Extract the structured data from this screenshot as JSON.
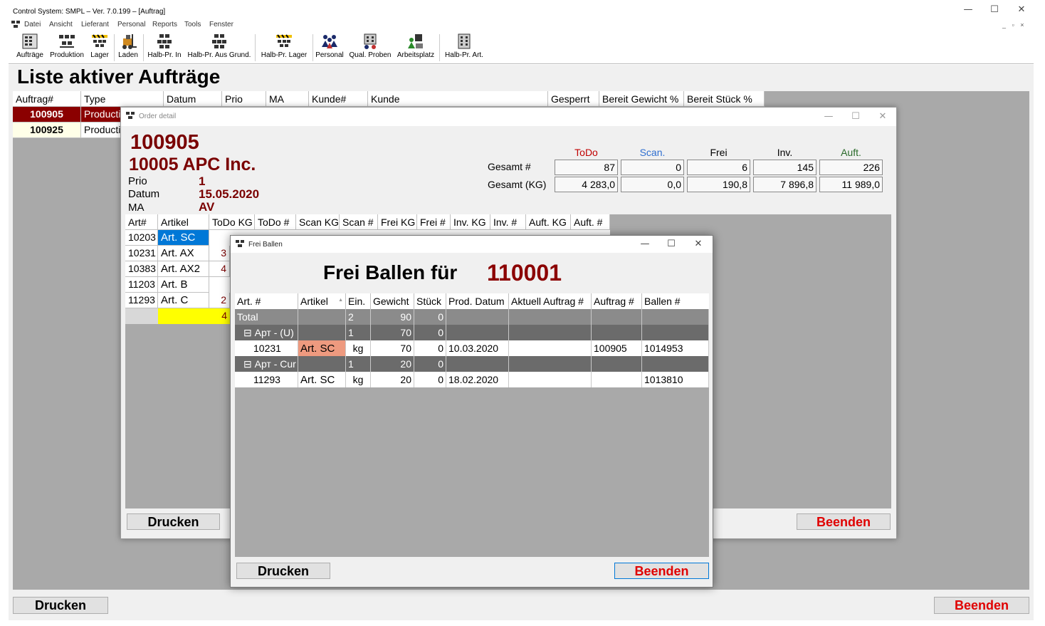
{
  "window": {
    "title": "Control System: SMPL – Ver. 7.0.199 – [Auftrag]",
    "minimize_glyph": "—",
    "maximize_glyph": "☐",
    "close_glyph": "✕",
    "mdi_controls": "_ ▫ ×"
  },
  "menu": [
    "Datei",
    "Ansicht",
    "Lieferant",
    "Personal",
    "Reports",
    "Tools",
    "Fenster"
  ],
  "toolbar": [
    {
      "label": "Aufträge",
      "icon": "orders-icon"
    },
    {
      "label": "Produktion",
      "icon": "production-icon"
    },
    {
      "label": "Lager",
      "icon": "warehouse-icon"
    },
    {
      "label": "Laden",
      "icon": "forklift-icon"
    },
    {
      "label": "Halb-Pr. In",
      "icon": "semi-product-in-icon"
    },
    {
      "label": "Halb-Pr. Aus Grund.",
      "icon": "semi-product-out-icon"
    },
    {
      "label": "Halb-Pr. Lager",
      "icon": "semi-product-warehouse-icon"
    },
    {
      "label": "Personal",
      "icon": "staff-icon"
    },
    {
      "label": "Qual. Proben",
      "icon": "quality-samples-icon"
    },
    {
      "label": "Arbeitsplatz",
      "icon": "workplace-icon"
    },
    {
      "label": "Halb-Pr. Art.",
      "icon": "semi-product-article-icon"
    }
  ],
  "main": {
    "title": "Liste aktiver Aufträge",
    "columns": [
      "Auftrag#",
      "Type",
      "Datum",
      "Prio",
      "MA",
      "Kunde#",
      "Kunde",
      "Gesperrt",
      "Bereit Gewicht %",
      "Bereit Stück %"
    ],
    "rows": [
      {
        "order": "100905",
        "type": "Productio",
        "selected": true
      },
      {
        "order": "100925",
        "type": "Productio",
        "selected": false
      }
    ],
    "print_label": "Drucken",
    "exit_label": "Beenden"
  },
  "order_detail": {
    "title": "Order detail",
    "order_number": "100905",
    "customer": "10005 APC Inc.",
    "fields": [
      {
        "label": "Prio",
        "value": "1"
      },
      {
        "label": "Datum",
        "value": "15.05.2020"
      },
      {
        "label": "MA",
        "value": "AV"
      }
    ],
    "summary_headers": [
      {
        "label": "ToDo",
        "color": "#c00000"
      },
      {
        "label": "Scan.",
        "color": "#2f6fd0"
      },
      {
        "label": "Frei",
        "color": "#000000"
      },
      {
        "label": "Inv.",
        "color": "#000000"
      },
      {
        "label": "Auft.",
        "color": "#2a6a2a"
      }
    ],
    "summary_rows": [
      {
        "label": "Gesamt #",
        "values": [
          "87",
          "0",
          "6",
          "145",
          "226"
        ]
      },
      {
        "label": "Gesamt (KG)",
        "values": [
          "4 283,0",
          "0,0",
          "190,8",
          "7 896,8",
          "11 989,0"
        ]
      }
    ],
    "columns": [
      "Art#",
      "Artikel",
      "ToDo KG",
      "ToDo #",
      "Scan KG",
      "Scan #",
      "Frei KG",
      "Frei #",
      "Inv. KG",
      "Inv. #",
      "Auft. KG",
      "Auft. #"
    ],
    "rows": [
      {
        "art": "10203",
        "artikel": "Art. SC",
        "todo_kg": "",
        "selected": true
      },
      {
        "art": "10231",
        "artikel": "Art. AX",
        "todo_kg": "3",
        "selected": false
      },
      {
        "art": "10383",
        "artikel": "Art. AX2",
        "todo_kg": "4",
        "selected": false
      },
      {
        "art": "11203",
        "artikel": "Art. B",
        "todo_kg": "",
        "selected": false
      },
      {
        "art": "11293",
        "artikel": "Art. C",
        "todo_kg": "2",
        "selected": false
      }
    ],
    "total_partial": "4",
    "print_label": "Drucken",
    "exit_label": "Beenden"
  },
  "frei_ballen": {
    "title": "Frei Ballen",
    "heading": "Frei Ballen für",
    "heading_number": "110001",
    "columns": [
      "Art. #",
      "Artikel",
      "Ein.",
      "Gewicht",
      "Stück",
      "Prod. Datum",
      "Aktuell Auftrag #",
      "Auftrag #",
      "Ballen #"
    ],
    "sort_glyph": "▲",
    "rows": [
      {
        "kind": "total",
        "cells": [
          "Total",
          "",
          "2",
          "90",
          "0",
          "",
          "",
          "",
          ""
        ]
      },
      {
        "kind": "group",
        "cells": [
          "⊟ Арт - (U)",
          "",
          "1",
          "70",
          "0",
          "",
          "",
          "",
          ""
        ]
      },
      {
        "kind": "item",
        "cells": [
          "10231",
          "Art. SC",
          "kg",
          "70",
          "0",
          "10.03.2020",
          "",
          "100905",
          "1014953"
        ],
        "highlight": "#ee9a7f"
      },
      {
        "kind": "group",
        "cells": [
          "⊟ Арт - Cur",
          "",
          "1",
          "20",
          "0",
          "",
          "",
          "",
          ""
        ]
      },
      {
        "kind": "item",
        "cells": [
          "11293",
          "Art. SC",
          "kg",
          "20",
          "0",
          "18.02.2020",
          "",
          "",
          "1013810"
        ],
        "highlight": ""
      }
    ],
    "print_label": "Drucken",
    "exit_label": "Beenden"
  },
  "colors": {
    "selected_row": "#8b0000",
    "accent_blue": "#0078d7",
    "dark_red_text": "#7a0000",
    "exit_red": "#e00000",
    "total_yellow": "#ffff00"
  }
}
